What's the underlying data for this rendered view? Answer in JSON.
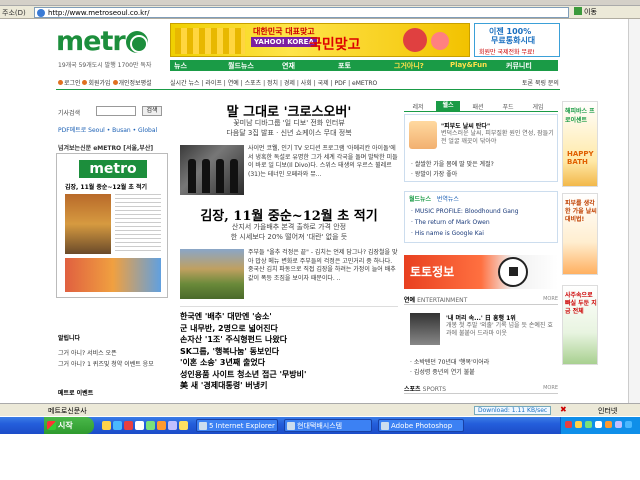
{
  "browser": {
    "address_label": "주소(D)",
    "url": "http://www.metroseoul.co.kr/",
    "go_label": "이동"
  },
  "header": {
    "tagline": "19개국 59개도시 발행 1700만 독자",
    "banner": {
      "line1": "대한민국 대표맞고",
      "brand": "YAHOO! KOREA",
      "title": "국민맞고"
    },
    "ad": {
      "line1": "이젠 100%",
      "line2": "무료통화시대",
      "line3": "회원만 국제전화 무료!"
    }
  },
  "nav": {
    "items": [
      "뉴스",
      "월드뉴스",
      "연재",
      "포토",
      "그거아니?",
      "Play&Fun",
      "커뮤니티"
    ]
  },
  "subnav": {
    "items": "실시간 뉴스 | 라이프 | 연예 | 스포츠 | 정치 | 경제 | 사회 | 국제 | PDF | eMETRO",
    "right": "토론 북링 문의"
  },
  "login": {
    "items": [
      "로그인",
      "회원가입",
      "개인정보평설"
    ]
  },
  "leftcol": {
    "search_label": "기사검색",
    "search_button": "검색",
    "edition_links": "PDF메트로 Seoul • Busan • Global",
    "thumb_title": "넘겨보는신문 eMETRO [서울,부산]",
    "thumb_logo": "metro",
    "thumb_head": "김장, 11월 중순~12월 초 적기",
    "section1_title": "알립니다",
    "section1_item": "그거 아니? 서비스 오픈",
    "section1_sub": "그거 아니? 1 퀴즈및 청약 이벤트 응모",
    "section2_title": "메트로 이벤트"
  },
  "center": {
    "headline1": "말 그대로 '크로스오버'",
    "sub1a": "꽃미남 디바그룹 '일 디보' 전화 인터뷰",
    "sub1b": "다음달 3집 발표 · 신년 쇼케이스 무대 정복",
    "body1": "사이먼 코웰, 인기 TV 오디션 프로그램 '아메리칸 아이돌'에서 냉혹한 독설로 유명한 그가 세계 각국을 돌며 발탁한 미들이 바로 일 디보(Il Divo)다. 스위스 태생의 우르스 뷜레르(31)는 테너인 오페라와 뮤...",
    "headline2": "김장, 11월 중순~12월 초 적기",
    "sub2a": "산지서 가을배추 본격 출하로 가격 안정",
    "sub2b": "한 시세보다 20% 떨어져 '대란' 없을 듯",
    "body2": "주부들 \"올추 걱정은 끝\" - 김치는 언제 담그나? 김장철을 맞아 밥상 메뉴 변화로 주부들의 걱정은 고민거리 중 하나다. 중국산 김치 파동으로 직접 김장을 하려는 가정이 늘어 배추 값이 폭등 조짐을 보이자 때문이다. ..",
    "news": [
      "한국엔 '배추' 대만엔 '숭소'",
      "군 내무반, 2명으로 넓어진다",
      "손자산 '1조' 주식형펀드 나왔다",
      "SK그룹, '행복나눔' 동보인다",
      "'이혼 소송' 3년째 출었다",
      "성인용품 사이트 청소년 접근 '무방비'",
      "美 새 '경제대통령' 버냉키"
    ]
  },
  "rightcol": {
    "tabs": [
      "레저",
      "웰스",
      "패션",
      "푸드",
      "게임"
    ],
    "feature_title": "\"피부도 날씨 탄다\"",
    "feature_text": "변덕스러운 날씨, 피부질환 원인 연성, 잠들기 전 얼굴 깨끗이 닦아야",
    "bullets": [
      "· 쌀쌀한 가을 몸에 딸 맞은 계절?",
      "· 왕발이 가장 좋아"
    ],
    "subtabs": [
      "월드뉴스",
      "번역뉴스"
    ],
    "world": [
      "· MUSIC PROFILE: Bloodhound Gang",
      "· The return of Mark Owen",
      "· His name is Google Kai"
    ],
    "toto": "토토정보",
    "ent_header": "연예",
    "ent_header_en": "ENTERTAINMENT",
    "ent_more": "MORE",
    "ent_title": "'내 머리 속...' 日 흥행 1위",
    "ent_text": "개봉 첫 주말 '외출' 기록 넘을 듯 손예진 효과에 불붙어 드라마 이웃",
    "ent_list": [
      "· 소박텐던 70년대 '행복'이어라",
      "· 김성령 중년의 연기 불붙"
    ],
    "sports_header": "스포츠",
    "sports_header_en": "SPORTS",
    "sports_more": "MORE"
  },
  "ads": {
    "ad1_title": "해피바스 프로이센트",
    "ad1_brand": "HAPPY BATH",
    "ad2_text": "피부를 생각한 가을 날씨 대비법!",
    "ad3_text": "사주속으로 빠실 두둔 지금 전체"
  },
  "status": {
    "text": "메트로신문사",
    "download": "Download: 1.11 KB/sec",
    "zone": "인터넷"
  },
  "taskbar": {
    "start": "시작",
    "tasks": [
      "5 Internet Explorer",
      "현대택배시스템",
      "Adobe Photoshop"
    ]
  }
}
